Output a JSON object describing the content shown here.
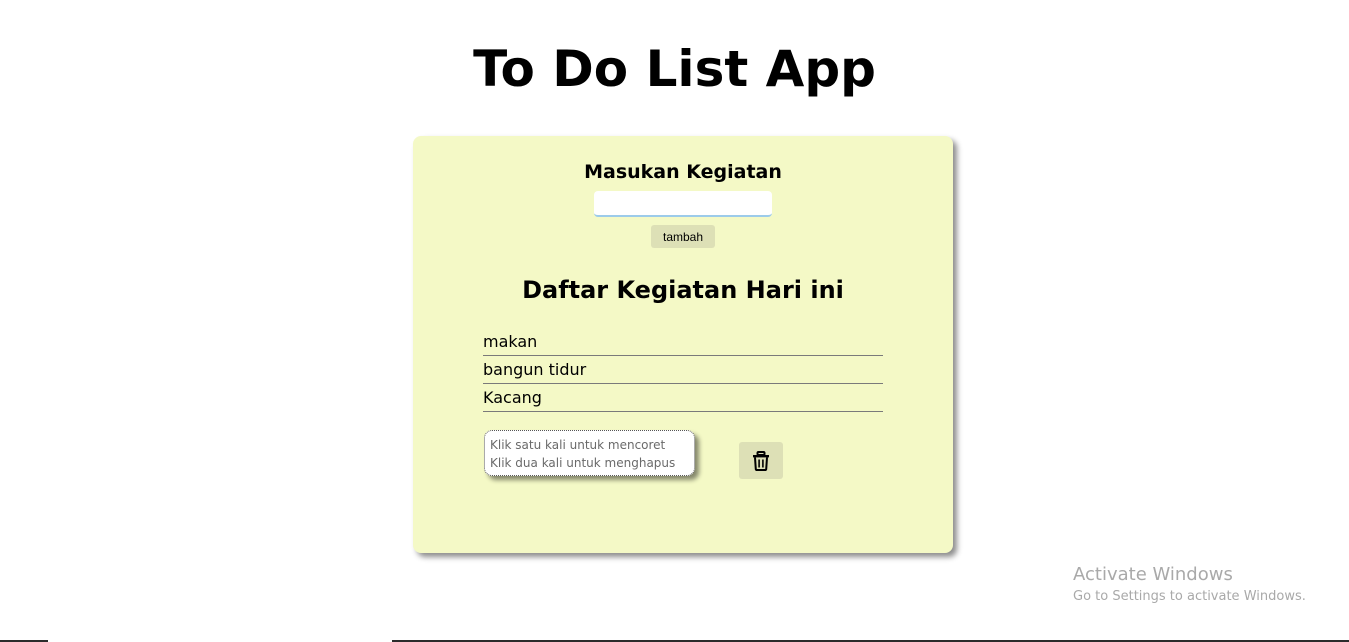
{
  "app": {
    "title": "To Do List App"
  },
  "input_section": {
    "heading": "Masukan Kegiatan",
    "input_value": "",
    "input_placeholder": "",
    "add_label": "tambah"
  },
  "list_section": {
    "heading": "Daftar Kegiatan Hari ini",
    "items": [
      {
        "label": "makan"
      },
      {
        "label": "bangun tidur"
      },
      {
        "label": "Kacang"
      }
    ]
  },
  "hint": {
    "line1": "Klik satu kali untuk mencoret",
    "line2": "Klik dua kali untuk menghapus"
  },
  "delete_button": {
    "icon": "trash-icon"
  },
  "watermark": {
    "title": "Activate Windows",
    "subtitle": "Go to Settings to activate Windows."
  },
  "colors": {
    "card_background": "#f4f9c6",
    "button_background": "#dde0b6",
    "input_focus_border": "#9ccbea"
  }
}
